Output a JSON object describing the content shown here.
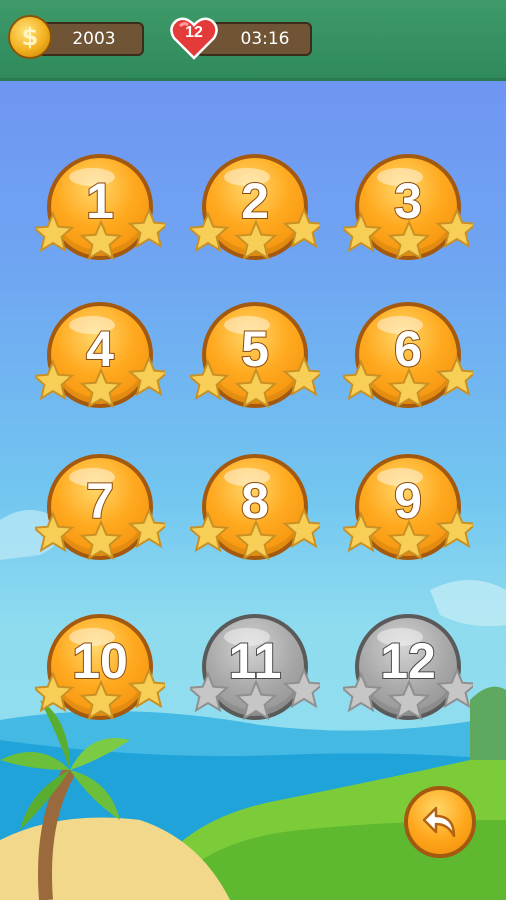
{
  "header": {
    "coins": "2003",
    "lives": "12",
    "timer": "03:16",
    "coin_symbol": "$"
  },
  "levels": [
    {
      "label": "1",
      "locked": false
    },
    {
      "label": "2",
      "locked": false
    },
    {
      "label": "3",
      "locked": false
    },
    {
      "label": "4",
      "locked": false
    },
    {
      "label": "5",
      "locked": false
    },
    {
      "label": "6",
      "locked": false
    },
    {
      "label": "7",
      "locked": false
    },
    {
      "label": "8",
      "locked": false
    },
    {
      "label": "9",
      "locked": false
    },
    {
      "label": "10",
      "locked": false
    },
    {
      "label": "11",
      "locked": true
    },
    {
      "label": "12",
      "locked": true
    }
  ],
  "icons": {
    "coin": "coin-icon",
    "heart": "heart-icon",
    "back": "back-arrow-icon",
    "star": "star-icon"
  },
  "colors": {
    "topbar": "#2f8a5c",
    "level_unlocked": "#ffa91f",
    "level_locked": "#a8a8a8",
    "star_gold": "#f7cf57",
    "star_grey": "#c6c6c6"
  }
}
